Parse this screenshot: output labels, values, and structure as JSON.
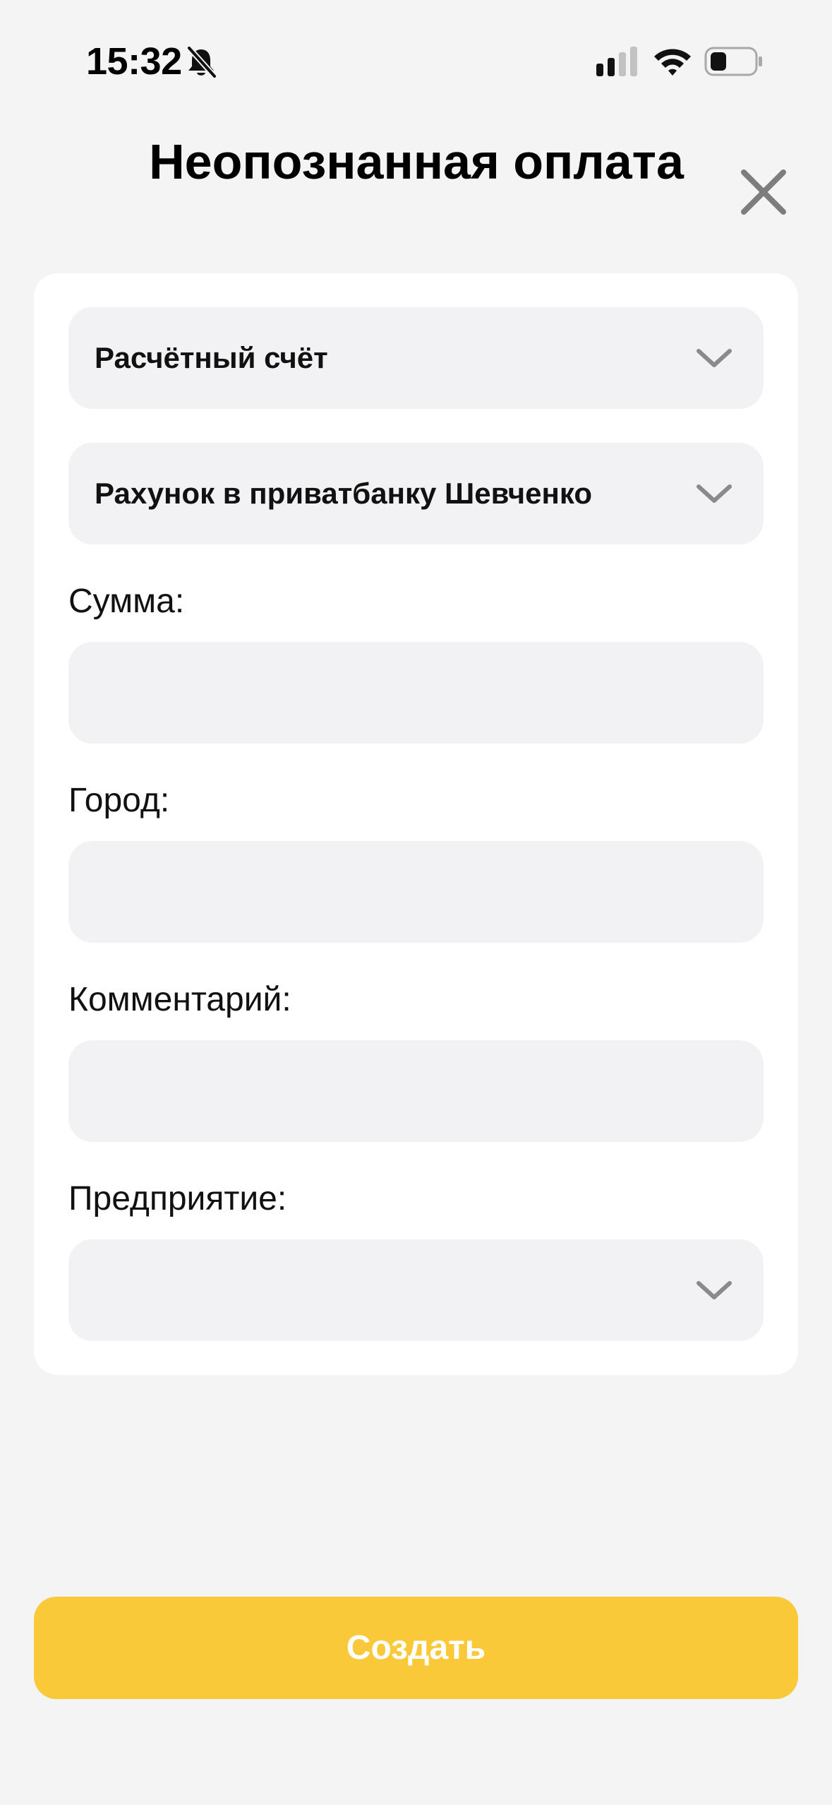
{
  "status_bar": {
    "time": "15:32",
    "icons": [
      "bell-slash-icon",
      "cellular-signal-icon",
      "wifi-icon",
      "battery-icon"
    ]
  },
  "header": {
    "title": "Неопознанная оплата",
    "close_icon": "close-icon"
  },
  "form": {
    "account_type_select": {
      "value": "Расчётный счёт"
    },
    "account_select": {
      "value": "Рахунок в приватбанку Шевченко"
    },
    "amount": {
      "label": "Сумма:",
      "value": ""
    },
    "city": {
      "label": "Город:",
      "value": ""
    },
    "comment": {
      "label": "Комментарий:",
      "value": ""
    },
    "enterprise": {
      "label": "Предприятие:",
      "value": ""
    }
  },
  "actions": {
    "create_label": "Создать"
  },
  "colors": {
    "background": "#f4f4f5",
    "card": "#ffffff",
    "field": "#f2f2f4",
    "accent": "#fac93a",
    "icon_gray": "#7d7d7d"
  }
}
